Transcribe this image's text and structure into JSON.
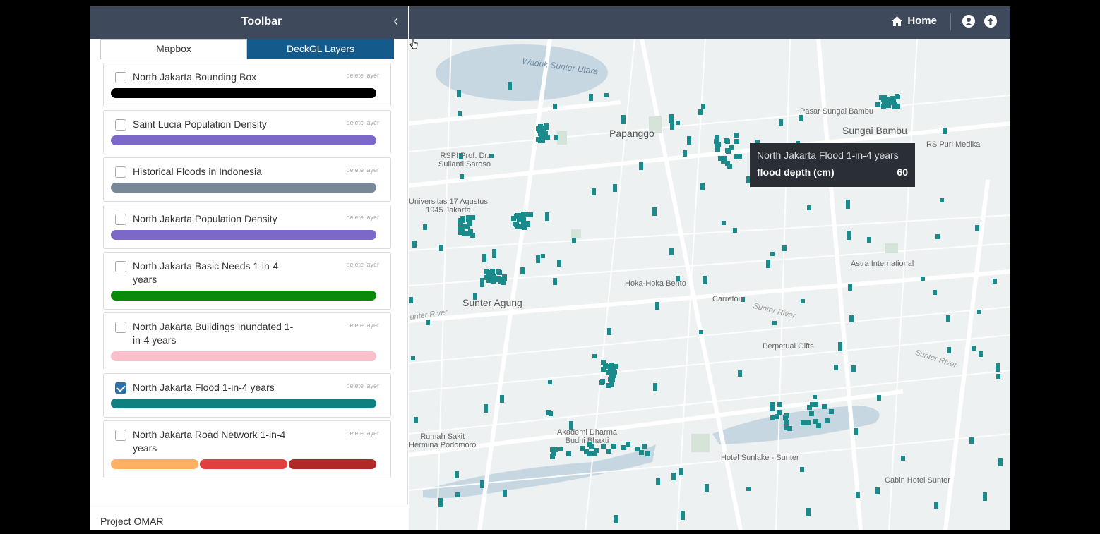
{
  "sidebar": {
    "title": "Toolbar",
    "collapse_icon": "chevron-left-icon",
    "tabs": [
      {
        "label": "Mapbox",
        "active": false
      },
      {
        "label": "DeckGL Layers",
        "active": true
      }
    ],
    "layers": [
      {
        "name": "North Jakarta Bounding Box",
        "checked": false,
        "delete_label": "delete layer",
        "colors": [
          "#000000"
        ]
      },
      {
        "name": "Saint Lucia Population Density",
        "checked": false,
        "delete_label": "delete layer",
        "colors": [
          "#7b68c8"
        ]
      },
      {
        "name": "Historical Floods in Indonesia",
        "checked": false,
        "delete_label": "delete layer",
        "colors": [
          "#778899"
        ]
      },
      {
        "name": "North Jakarta Population Density",
        "checked": false,
        "delete_label": "delete layer",
        "colors": [
          "#7b68c8"
        ]
      },
      {
        "name": "North Jakarta Basic Needs 1-in-4 years",
        "checked": false,
        "delete_label": "delete layer",
        "colors": [
          "#0a8a0a"
        ]
      },
      {
        "name": "North Jakarta Buildings Inundated 1-in-4 years",
        "checked": false,
        "delete_label": "delete layer",
        "colors": [
          "#f9c0cb"
        ]
      },
      {
        "name": "North Jakarta Flood 1-in-4 years",
        "checked": true,
        "delete_label": "delete layer",
        "colors": [
          "#0e8080"
        ]
      },
      {
        "name": "North Jakarta Road Network 1-in-4 years",
        "checked": false,
        "delete_label": "delete layer",
        "colors": [
          "#ffb060",
          "#e04040",
          "#b02828"
        ]
      }
    ],
    "footer": "Project OMAR"
  },
  "topbar": {
    "home_label": "Home",
    "home_icon": "home-icon",
    "user_icon": "user-icon",
    "upload_icon": "upload-icon"
  },
  "map": {
    "labels": {
      "waduk": "Waduk Sunter Utara",
      "papanggo": "Papanggo",
      "sungai_bambu": "Sungai Bambu",
      "pasar": "Pasar Sungai Bambu",
      "rs_puri": "RS Puri Medika",
      "rspi": "RSPI Prof. Dr.\nSulianti Saroso",
      "rspi_1": "RSPI Prof. Dr.",
      "rspi_2": "Sulianti Saroso",
      "univ_1": "Universitas 17 Agustus",
      "univ_2": "1945 Jakarta",
      "astra": "Astra International",
      "hoka": "Hoka-Hoka Bento",
      "carrefour": "Carrefour",
      "sunter_agung": "Sunter Agung",
      "sunter_river_1": "Sunter River",
      "sunter_river_2": "Sunter River",
      "sunter_river_3": "Sunter River",
      "perpetual": "Perpetual Gifts",
      "akademi_1": "Akademi Dharma",
      "akademi_2": "Budhi Bhakti",
      "rumah_1": "Rumah Sakit",
      "rumah_2": "Hermina Podomoro",
      "hotel": "Hotel Sunlake - Sunter",
      "cabin": "Cabin Hotel Sunter"
    },
    "accent_color": "#1a8a8a"
  },
  "tooltip": {
    "title": "North Jakarta Flood 1-in-4 years",
    "key": "flood depth (cm)",
    "value": "60"
  }
}
